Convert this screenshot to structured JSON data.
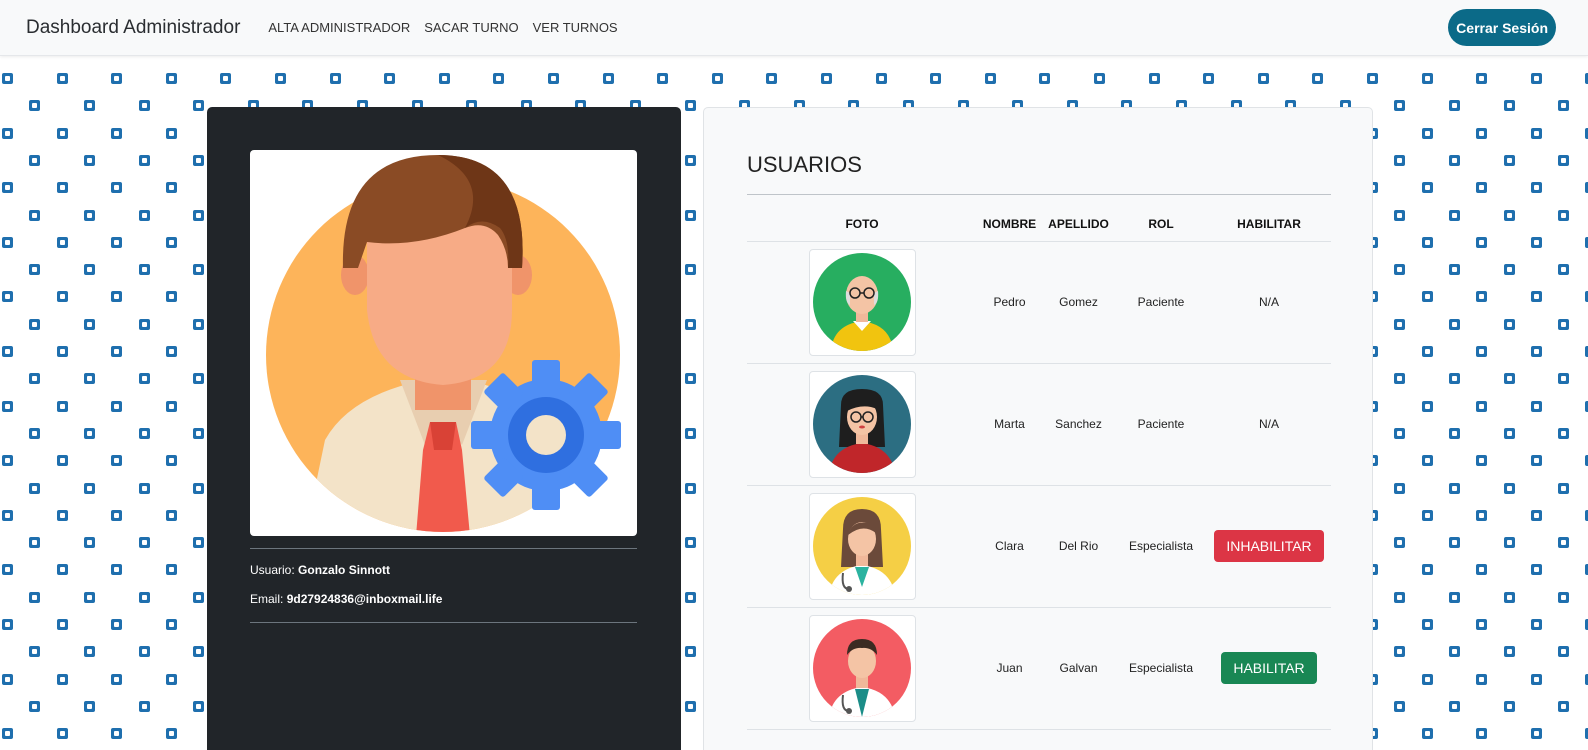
{
  "navbar": {
    "brand": "Dashboard Administrador",
    "links": [
      "ALTA ADMINISTRADOR",
      "SACAR TURNO",
      "VER TURNOS"
    ],
    "logout_label": "Cerrar Sesión"
  },
  "profile": {
    "user_label": "Usuario:",
    "user_value": "Gonzalo Sinnott",
    "email_label": "Email:",
    "email_value": "9d27924836@inboxmail.life"
  },
  "users": {
    "title": "USUARIOS",
    "columns": [
      "FOTO",
      "NOMBRE",
      "APELLIDO",
      "ROL",
      "HABILITAR"
    ],
    "rows": [
      {
        "nombre": "Pedro",
        "apellido": "Gomez",
        "rol": "Paciente",
        "habilitar": "N/A",
        "action": "none"
      },
      {
        "nombre": "Marta",
        "apellido": "Sanchez",
        "rol": "Paciente",
        "habilitar": "N/A",
        "action": "none"
      },
      {
        "nombre": "Clara",
        "apellido": "Del Rio",
        "rol": "Especialista",
        "habilitar": "INHABILITAR",
        "action": "disable"
      },
      {
        "nombre": "Juan",
        "apellido": "Galvan",
        "rol": "Especialista",
        "habilitar": "HABILITAR",
        "action": "enable"
      }
    ]
  },
  "colors": {
    "accent": "#0b6a88",
    "danger": "#dc3545",
    "success": "#198754",
    "pattern": "#1f6fae"
  }
}
